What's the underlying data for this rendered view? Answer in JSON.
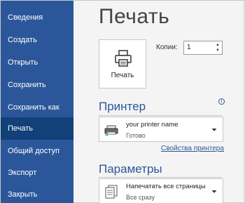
{
  "sidebar": {
    "items": [
      {
        "label": "Сведения"
      },
      {
        "label": "Создать"
      },
      {
        "label": "Открыть"
      },
      {
        "label": "Сохранить"
      },
      {
        "label": "Сохранить как"
      },
      {
        "label": "Печать"
      },
      {
        "label": "Общий доступ"
      },
      {
        "label": "Экспорт"
      },
      {
        "label": "Закрыть"
      }
    ],
    "active_item": "Печать"
  },
  "main": {
    "title": "Печать",
    "print_button": {
      "label": "Печать",
      "icon": "printer-icon"
    },
    "copies": {
      "label": "Копии:",
      "value": "1"
    },
    "printer_section": {
      "title": "Принтер",
      "printer_name": "your printer name",
      "printer_status": "Готово",
      "properties_link": "Свойства принтера"
    },
    "settings_section": {
      "title": "Параметры",
      "print_range": "Напечатать все страницы",
      "print_range_sub": "Все сразу"
    }
  },
  "colors": {
    "sidebar_bg": "#2b579a",
    "sidebar_active": "#124078",
    "accent": "#2b579a"
  }
}
